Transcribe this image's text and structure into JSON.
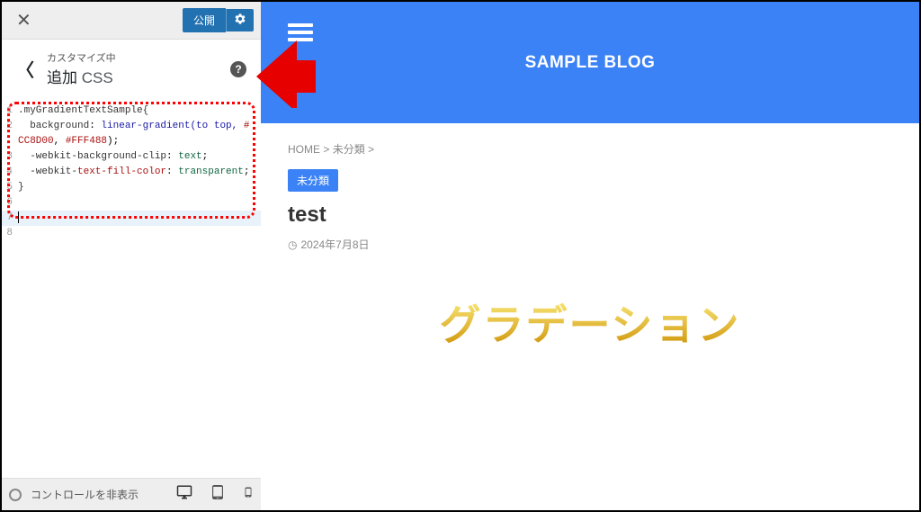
{
  "sidebar": {
    "publish_label": "公開",
    "customizing_label": "カスタマイズ中",
    "section_prefix": "追加",
    "section_suffix": "CSS",
    "code": {
      "line1": ".myGradientTextSample{",
      "line2_prop": "  background",
      "line2_val": "linear-gradient",
      "line2_args": "(to top,",
      "line3_hex1": "#CC8D00",
      "line3_hex2": "#FFF488",
      "line4_prop": "  -webkit-",
      "line4_prop2": "background-clip",
      "line4_val": "text",
      "line5_prop": "  -webkit-",
      "line5_prop2": "text-fill-color",
      "line5_val": "transparent",
      "line6": "}"
    },
    "footer_text": "コントロールを非表示"
  },
  "preview": {
    "blog_title": "SAMPLE BLOG",
    "breadcrumb_home": "HOME",
    "breadcrumb_cat": "未分類",
    "category_tag": "未分類",
    "post_title": "test",
    "post_date": "2024年7月8日",
    "gradient_text": "グラデーション"
  }
}
